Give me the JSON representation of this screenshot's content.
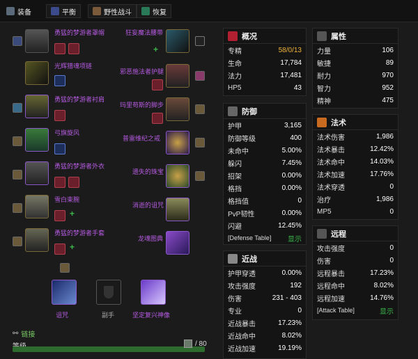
{
  "tabs": [
    {
      "label": "装备",
      "icon": "armor-icon"
    },
    {
      "label": "平衡",
      "icon": "moon-icon"
    },
    {
      "label": "野性战斗",
      "icon": "cat-icon"
    },
    {
      "label": "恢复",
      "icon": "leaf-icon"
    }
  ],
  "left_items": [
    "勇猛的梦游者罩帽",
    "光辉猎魂项链",
    "勇猛的梦游者衬肩",
    "弓旗旋风",
    "勇猛的梦游者外衣",
    "雪白束腕",
    "勇猛的梦游者手套"
  ],
  "right_items": [
    "狂妄魔法腰带",
    "邪恶施法者护腿",
    "玛里苟斯的脚步",
    "普雷维纪之戒",
    "遗失的珠宝",
    "消逝的诅咒",
    "龙魂图典"
  ],
  "weapons": [
    "诅咒",
    "副手",
    "坚定复兴神像"
  ],
  "bottom": {
    "link_label": "链接",
    "level_label": "等级",
    "level_value": "/ 80"
  },
  "panels": {
    "overview": {
      "title": "概况",
      "rows": [
        [
          "专精",
          "58/0/13"
        ],
        [
          "生命",
          "17,784"
        ],
        [
          "法力",
          "17,481"
        ],
        [
          "HP5",
          "43"
        ]
      ]
    },
    "attributes": {
      "title": "属性",
      "rows": [
        [
          "力量",
          "106"
        ],
        [
          "敏捷",
          "89"
        ],
        [
          "耐力",
          "970"
        ],
        [
          "智力",
          "952"
        ],
        [
          "精神",
          "475"
        ]
      ]
    },
    "defense": {
      "title": "防御",
      "rows": [
        [
          "护甲",
          "3,165"
        ],
        [
          "防御等级",
          "400"
        ],
        [
          "未命中",
          "5.00%"
        ],
        [
          "躲闪",
          "7.45%"
        ],
        [
          "招架",
          "0.00%"
        ],
        [
          "格挡",
          "0.00%"
        ],
        [
          "格挡值",
          "0"
        ],
        [
          "PvP韧性",
          "0.00%"
        ],
        [
          "闪避",
          "12.45%"
        ]
      ],
      "table_label": "[Defense Table]",
      "show_label": "显示"
    },
    "spell": {
      "title": "法术",
      "rows": [
        [
          "法术伤害",
          "1,986"
        ],
        [
          "法术暴击",
          "12.42%"
        ],
        [
          "法术命中",
          "14.03%"
        ],
        [
          "法术加速",
          "17.76%"
        ],
        [
          "法术穿透",
          "0"
        ],
        [
          "治疗",
          "1,986"
        ],
        [
          "MP5",
          "0"
        ]
      ]
    },
    "melee": {
      "title": "近战",
      "rows": [
        [
          "护甲穿透",
          "0.00%"
        ],
        [
          "攻击强度",
          "192"
        ],
        [
          "伤害",
          "231 - 403"
        ],
        [
          "专业",
          "0"
        ],
        [
          "近战暴击",
          "17.23%"
        ],
        [
          "近战命中",
          "8.02%"
        ],
        [
          "近战加速",
          "19.19%"
        ]
      ]
    },
    "ranged": {
      "title": "远程",
      "rows": [
        [
          "攻击强度",
          "0"
        ],
        [
          "伤害",
          "0"
        ],
        [
          "远程暴击",
          "17.23%"
        ],
        [
          "远程命中",
          "8.02%"
        ],
        [
          "远程加速",
          "14.76%"
        ]
      ],
      "table_label": "[Attack Table]",
      "show_label": "显示"
    }
  },
  "colors": {
    "item_name": "#b55be0",
    "gem_plus": "#3bb54a",
    "highlight_yellow": "#f0b43c"
  }
}
